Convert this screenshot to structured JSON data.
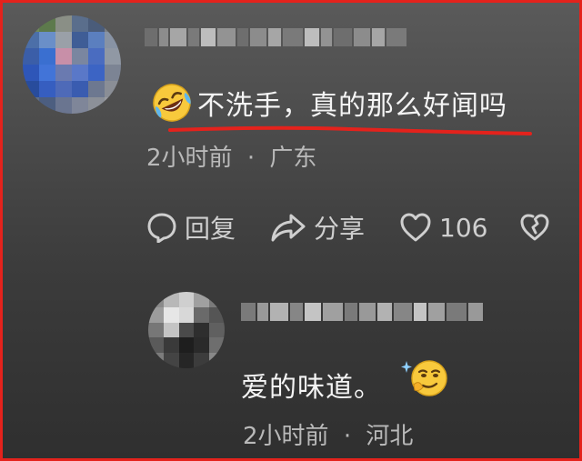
{
  "main_comment": {
    "emoji": "rolling-laughing-emoji",
    "text": "不洗手，真的那么好闻吗",
    "time": "2小时前",
    "separator": "·",
    "location": "广东",
    "highlight_color": "#e4221c"
  },
  "actions": {
    "reply_label": "回复",
    "share_label": "分享",
    "like_count": "106",
    "icons": [
      "comment-bubble-icon",
      "share-arrow-icon",
      "heart-icon",
      "broken-heart-icon"
    ]
  },
  "reply_comment": {
    "text": "爱的味道。",
    "emoji": "smirk-sparkle-emoji",
    "time": "2小时前",
    "separator": "·",
    "location": "河北"
  },
  "colors": {
    "frame": "#e4221c",
    "text": "#f4f4f4",
    "meta": "#b9b9b9",
    "icon": "#cfcfcf"
  }
}
